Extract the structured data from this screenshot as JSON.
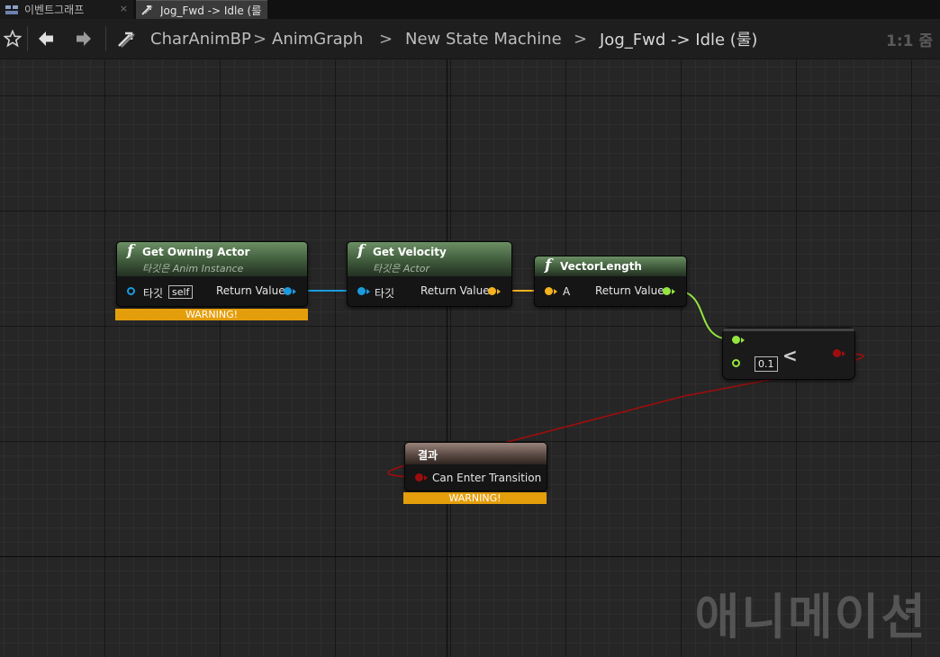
{
  "tabs": [
    {
      "label": "이벤트그래프",
      "close": "×"
    },
    {
      "label": "Jog_Fwd -> Idle (룰",
      "close": "×"
    }
  ],
  "breadcrumb": [
    "CharAnimBP",
    "AnimGraph",
    "New State Machine",
    "Jog_Fwd -> Idle (룰)"
  ],
  "breadcrumb_separator": ">",
  "zoom": "1:1 줌",
  "nodes": {
    "get_owning_actor": {
      "icon": "f",
      "title": "Get Owning Actor",
      "subtitle": "타깃은 Anim Instance",
      "target_label": "타깃",
      "target_value": "self",
      "output_label": "Return Value",
      "warning": "WARNING!"
    },
    "get_velocity": {
      "icon": "f",
      "title": "Get Velocity",
      "subtitle": "타깃은 Actor",
      "target_label": "타깃",
      "output_label": "Return Value"
    },
    "vector_length": {
      "icon": "f",
      "title": "VectorLength",
      "input_label": "A",
      "output_label": "Return Value"
    },
    "less_than": {
      "operator": "<",
      "b_value": "0.1"
    },
    "result": {
      "title": "결과",
      "input_label": "Can Enter Transition",
      "warning": "WARNING!"
    }
  },
  "watermark": "애니메이션",
  "colors": {
    "object_pin": "#1a9bdf",
    "vector_pin": "#f5b220",
    "float_pin": "#94e540",
    "bool_pin": "#9d0d0d",
    "warning": "#e59e0b",
    "function_header": "#4d6b48",
    "result_header": "#6e5a53"
  },
  "icons": [
    "star-icon",
    "back-arrow-icon",
    "forward-arrow-icon",
    "blueprint-transition-icon",
    "event-graph-icon"
  ]
}
